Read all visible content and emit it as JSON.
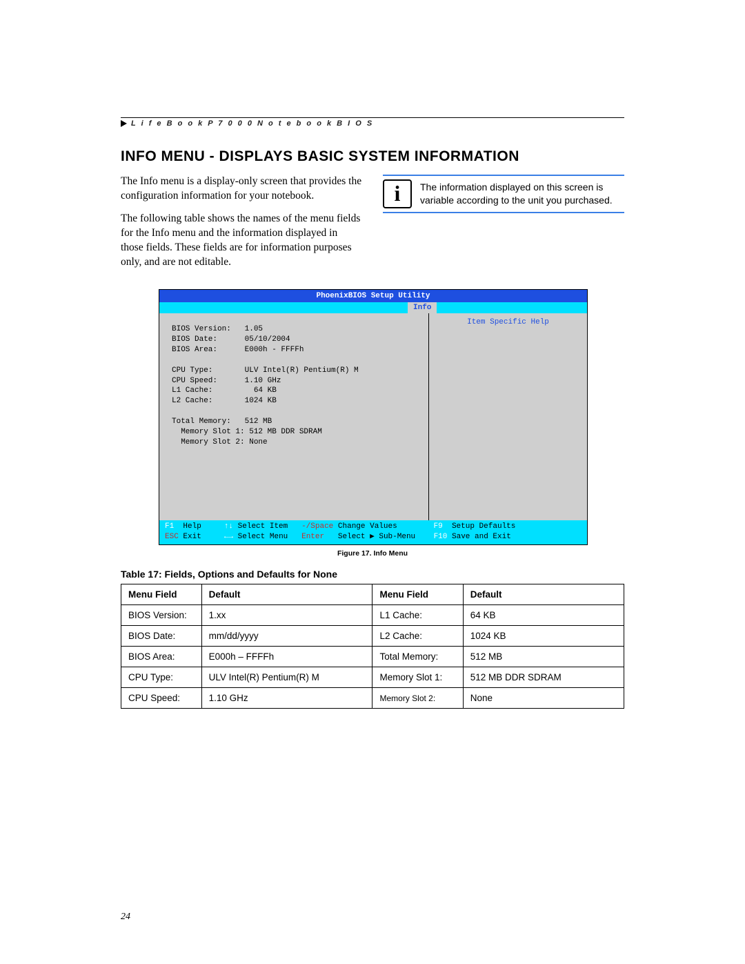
{
  "header": {
    "running": "L i f e B o o k   P 7 0 0 0   N o t e b o o k   B I O S"
  },
  "title": "INFO MENU - DISPLAYS BASIC SYSTEM INFORMATION",
  "paras": {
    "p1": "The Info menu is a display-only screen that provides the configuration information for your notebook.",
    "p2": "The following table shows the names of the menu fields for the Info menu and the information displayed in those fields. These fields are for information purposes only, and are not editable.",
    "note": "The information displayed on this screen is variable according to the unit you purchased."
  },
  "bios": {
    "utility_title": "PhoenixBIOS Setup Utility",
    "tab": "Info",
    "help_header": "Item Specific Help",
    "lines": [
      "BIOS Version:   1.05",
      "BIOS Date:      05/10/2004",
      "BIOS Area:      E000h - FFFFh",
      "",
      "CPU Type:       ULV Intel(R) Pentium(R) M",
      "CPU Speed:      1.10 GHz",
      "L1 Cache:         64 KB",
      "L2 Cache:       1024 KB",
      "",
      "Total Memory:   512 MB",
      "  Memory Slot 1: 512 MB DDR SDRAM",
      "  Memory Slot 2: None"
    ],
    "footer": {
      "l1": {
        "k1": "F1",
        "t1": "Help",
        "k2": "↑↓",
        "t2": "Select Item",
        "k3": "-/Space",
        "t3": "Change Values",
        "k4": "F9",
        "t4": "Setup Defaults"
      },
      "l2": {
        "k1": "ESC",
        "t1": "Exit",
        "k2": "←→",
        "t2": "Select Menu",
        "k3": "Enter",
        "t3": "Select ▶ Sub-Menu",
        "k4": "F10",
        "t4": "Save and Exit"
      }
    }
  },
  "figure_caption": "Figure 17.  Info Menu",
  "table_title": "Table 17: Fields, Options and Defaults for None",
  "table": {
    "headers": {
      "h1": "Menu Field",
      "h2": "Default",
      "h3": "Menu Field",
      "h4": "Default"
    },
    "rows": [
      {
        "c1": "BIOS Version:",
        "c2": "1.xx",
        "c3": "L1 Cache:",
        "c4": "64 KB"
      },
      {
        "c1": "BIOS Date:",
        "c2": "mm/dd/yyyy",
        "c3": "L2 Cache:",
        "c4": "1024 KB"
      },
      {
        "c1": "BIOS Area:",
        "c2": "E000h – FFFFh",
        "c3": "Total Memory:",
        "c4": "512 MB"
      },
      {
        "c1": "CPU Type:",
        "c2": "ULV Intel(R) Pentium(R) M",
        "c3": "Memory Slot 1:",
        "c4": "512 MB DDR SDRAM"
      },
      {
        "c1": "CPU Speed:",
        "c2": "1.10 GHz",
        "c3": "Memory Slot 2:",
        "c4": "None",
        "c3small": true
      }
    ]
  },
  "page_number": "24"
}
